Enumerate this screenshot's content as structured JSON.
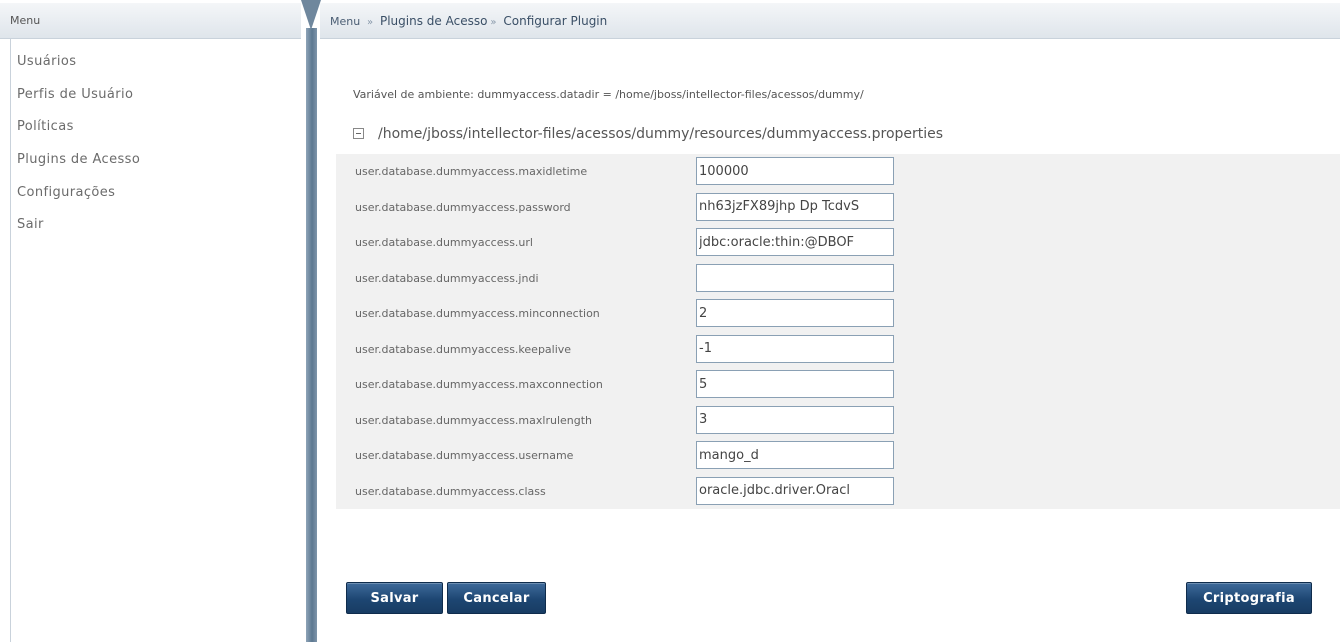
{
  "sidebar": {
    "title": "Menu",
    "items": [
      {
        "label": "Usuários"
      },
      {
        "label": "Perfis de Usuário"
      },
      {
        "label": "Políticas"
      },
      {
        "label": "Plugins de Acesso"
      },
      {
        "label": "Configurações"
      },
      {
        "label": "Sair"
      }
    ]
  },
  "breadcrumb": {
    "root": "Menu",
    "separator": "»",
    "items": [
      "Plugins de Acesso",
      "Configurar Plugin"
    ]
  },
  "main": {
    "env_line": "Variável de ambiente: dummyaccess.datadir = /home/jboss/intellector-files/acessos/dummy/",
    "file_path": "/home/jboss/intellector-files/acessos/dummy/resources/dummyaccess.properties",
    "properties": [
      {
        "label": "user.database.dummyaccess.maxidletime",
        "value": "100000"
      },
      {
        "label": "user.database.dummyaccess.password",
        "value": "nh63jzFX89jhp Dp TcdvS"
      },
      {
        "label": "user.database.dummyaccess.url",
        "value": "jdbc:oracle:thin:@DBOF"
      },
      {
        "label": "user.database.dummyaccess.jndi",
        "value": ""
      },
      {
        "label": "user.database.dummyaccess.minconnection",
        "value": "2"
      },
      {
        "label": "user.database.dummyaccess.keepalive",
        "value": "-1"
      },
      {
        "label": "user.database.dummyaccess.maxconnection",
        "value": "5"
      },
      {
        "label": "user.database.dummyaccess.maxlrulength",
        "value": "3"
      },
      {
        "label": "user.database.dummyaccess.username",
        "value": "mango_d"
      },
      {
        "label": "user.database.dummyaccess.class",
        "value": "oracle.jdbc.driver.Oracl"
      }
    ]
  },
  "buttons": {
    "save": "Salvar",
    "cancel": "Cancelar",
    "crypto": "Criptografia"
  },
  "colors": {
    "button_bg": "#1d4672",
    "divider": "#5c7890",
    "panel_bg": "#f1f1f1"
  }
}
